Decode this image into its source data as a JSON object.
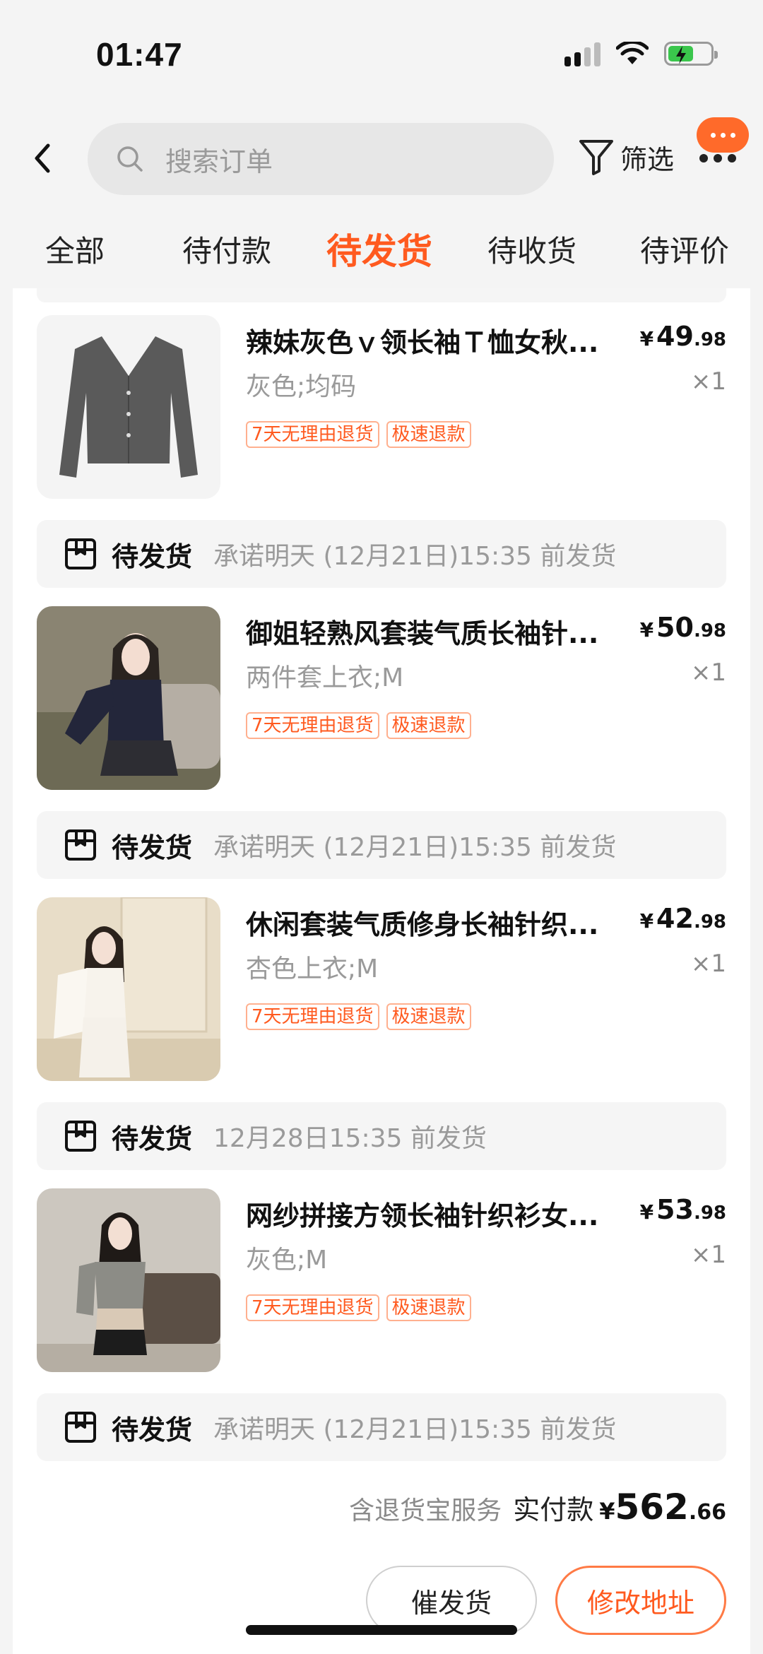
{
  "status_bar": {
    "time": "01:47",
    "battery_color": "#3ac64c"
  },
  "header": {
    "search_placeholder": "搜索订单",
    "filter_label": "筛选"
  },
  "tabs": [
    {
      "label": "全部",
      "active": false
    },
    {
      "label": "待付款",
      "active": false
    },
    {
      "label": "待发货",
      "active": true
    },
    {
      "label": "待收货",
      "active": false
    },
    {
      "label": "待评价",
      "active": false
    }
  ],
  "items": [
    {
      "title": "辣妹灰色ｖ领长袖Ｔ恤女秋...",
      "sku": "灰色;均码",
      "tags": [
        "7天无理由退货",
        "极速退款"
      ],
      "price_int": "49",
      "price_dec": ".98",
      "currency": "¥",
      "qty": "×1",
      "status_label": "待发货",
      "status_note": "承诺明天 (12月21日)15:35 前发货"
    },
    {
      "title": "御姐轻熟风套装气质长袖针...",
      "sku": "两件套上衣;M",
      "tags": [
        "7天无理由退货",
        "极速退款"
      ],
      "price_int": "50",
      "price_dec": ".98",
      "currency": "¥",
      "qty": "×1",
      "status_label": "待发货",
      "status_note": "承诺明天 (12月21日)15:35 前发货"
    },
    {
      "title": "休闲套装气质修身长袖针织...",
      "sku": "杏色上衣;M",
      "tags": [
        "7天无理由退货",
        "极速退款"
      ],
      "price_int": "42",
      "price_dec": ".98",
      "currency": "¥",
      "qty": "×1",
      "status_label": "待发货",
      "status_note": "12月28日15:35 前发货"
    },
    {
      "title": "网纱拼接方领长袖针织衫女...",
      "sku": "灰色;M",
      "tags": [
        "7天无理由退货",
        "极速退款"
      ],
      "price_int": "53",
      "price_dec": ".98",
      "currency": "¥",
      "qty": "×1",
      "status_label": "待发货",
      "status_note": "承诺明天 (12月21日)15:35 前发货"
    }
  ],
  "summary": {
    "service": "含退货宝服务",
    "label": "实付款",
    "currency": "¥",
    "amount_int": "562",
    "amount_dec": ".66"
  },
  "actions": {
    "urge": "催发货",
    "change_address": "修改地址"
  },
  "colors": {
    "accent": "#ff5a1f",
    "badge": "#ff6a2a"
  }
}
